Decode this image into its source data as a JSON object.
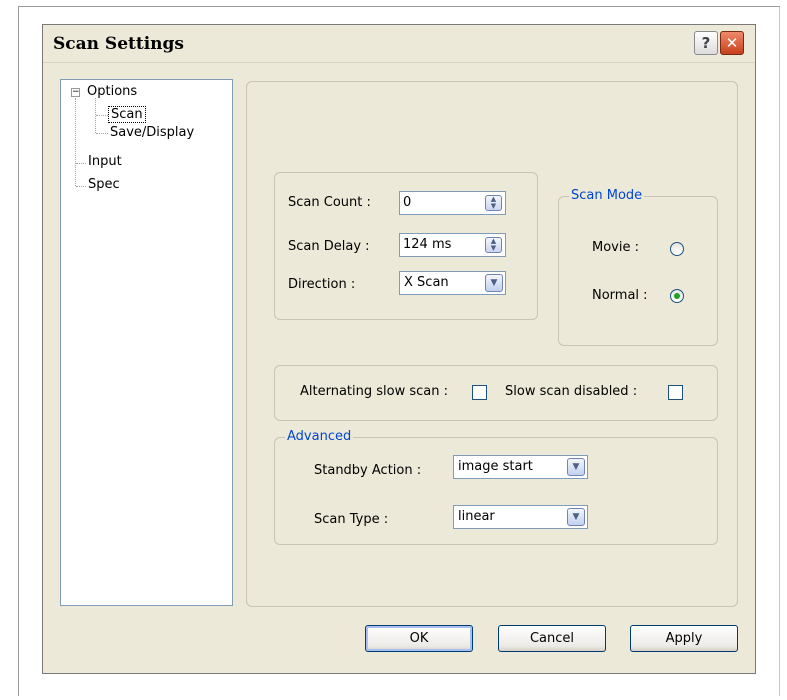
{
  "dialog": {
    "title": "Scan Settings",
    "help_label": "?",
    "close_label": "✕"
  },
  "tree": {
    "expander": "−",
    "items": [
      {
        "label": "Options"
      },
      {
        "label": "Scan"
      },
      {
        "label": "Save/Display"
      },
      {
        "label": "Input"
      },
      {
        "label": "Spec"
      }
    ]
  },
  "scan": {
    "count_label": "Scan Count :",
    "count_value": "0",
    "delay_label": "Scan Delay :",
    "delay_value": "124 ms",
    "direction_label": "Direction :",
    "direction_value": "X Scan"
  },
  "scan_mode": {
    "title": "Scan Mode",
    "movie_label": "Movie :",
    "normal_label": "Normal :",
    "selected": "Normal"
  },
  "slow_scan": {
    "alternating_label": "Alternating slow scan :",
    "alternating_checked": false,
    "disabled_label": "Slow scan disabled :",
    "disabled_checked": false
  },
  "advanced": {
    "title": "Advanced",
    "standby_label": "Standby Action :",
    "standby_value": "image start",
    "type_label": "Scan Type :",
    "type_value": "linear"
  },
  "buttons": {
    "ok": "OK",
    "cancel": "Cancel",
    "apply": "Apply"
  }
}
